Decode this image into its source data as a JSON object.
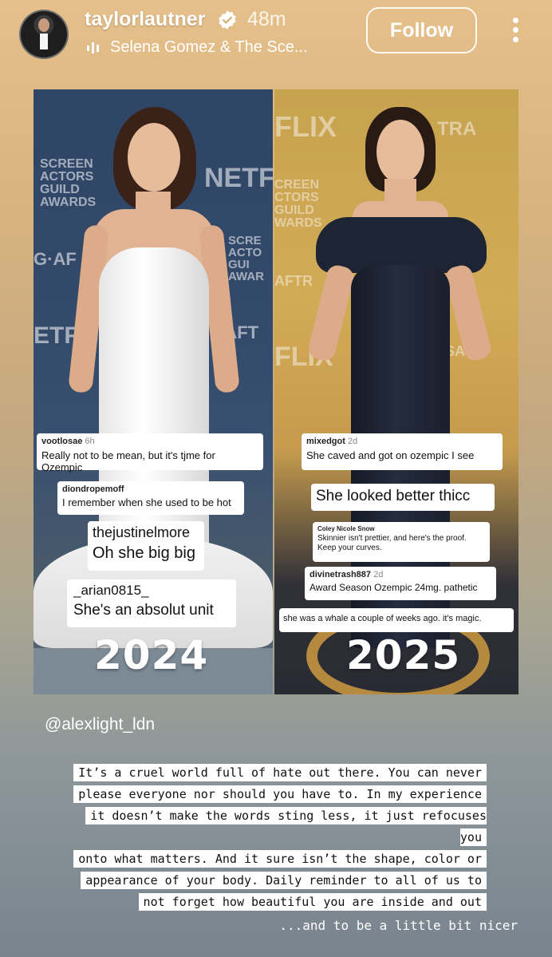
{
  "header": {
    "username": "taylorlautner",
    "time": "48m",
    "music": "Selena Gomez & The Sce...",
    "follow_label": "Follow"
  },
  "panels": {
    "left": {
      "backdrop": [
        "SCREEN",
        "ACTORS",
        "GUILD",
        "AWARDS",
        "NETFL",
        "SCRE",
        "ACTO",
        "GUI",
        "AWAR",
        "G·AF",
        "ETF",
        "·AFT"
      ],
      "comments": [
        {
          "user": "vootlosae",
          "time": "6h",
          "text": "Really not to be mean, but it's tjme for Ozempic"
        },
        {
          "user": "diondropemoff",
          "time": "",
          "text": "I remember when she used to be hot"
        },
        {
          "user": "thejustinelmore",
          "time": "",
          "text": "Oh she big big"
        },
        {
          "user": "_arian0815_",
          "time": "",
          "text": "She's an absolut unit"
        }
      ],
      "year": "2024"
    },
    "right": {
      "backdrop": [
        "FLIX",
        "TRA",
        "CREEN",
        "CTORS",
        "GUILD",
        "WARDS",
        "AFTR",
        "FLIX",
        "SA"
      ],
      "comments": [
        {
          "user": "mixedgot",
          "time": "2d",
          "text": "She caved and got on ozempic I see"
        },
        {
          "user": "",
          "time": "",
          "text": "She looked better thicc"
        },
        {
          "user": "Coley Nicole Snow",
          "time": "",
          "text": "Skinnier isn't prettier, and here's the proof. Keep your curves."
        },
        {
          "user": "divinetrash887",
          "time": "2d",
          "text": "Award Season Ozempic 24mg. pathetic"
        },
        {
          "user": "",
          "time": "",
          "text": "she was a whale a couple of weeks ago. it's magic."
        }
      ],
      "year": "2025"
    }
  },
  "mention": "@alexlight_ldn",
  "caption": {
    "lines": [
      "It’s a cruel world full of hate out there. You can never",
      "please everyone nor should you have to. In my experience",
      "it doesn’t make the words sting less, it just refocuses you",
      "onto what matters. And it sure isn’t the shape, color or",
      "appearance of your body. Daily reminder to all of us to",
      "not forget how beautiful you are inside and out"
    ],
    "tail": "...and to be a little bit nicer"
  },
  "icons": {
    "verified": "verified-badge-icon",
    "music": "music-bars-icon",
    "more": "more-vertical-icon"
  }
}
